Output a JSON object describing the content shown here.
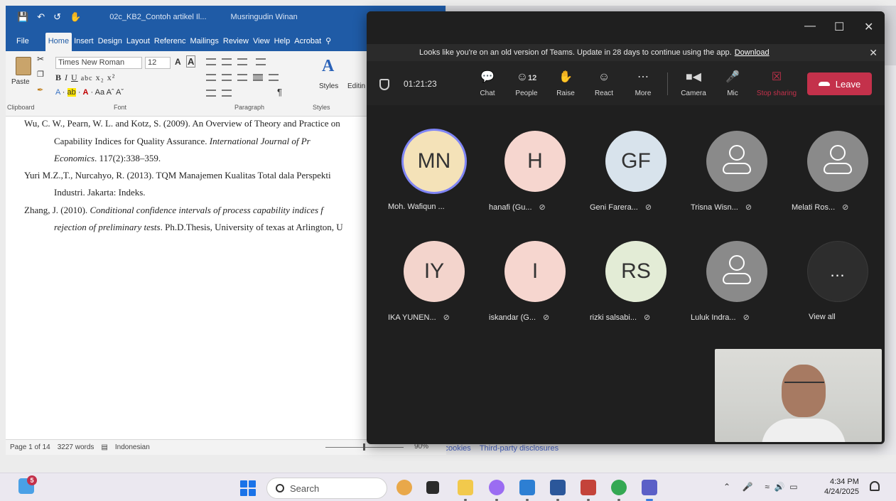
{
  "word": {
    "title": "02c_KB2_Contoh artikel Il...",
    "user": "Musringudin Winan",
    "tabs": [
      "File",
      "Home",
      "Insert",
      "Design",
      "Layout",
      "Referenc",
      "Mailings",
      "Review",
      "View",
      "Help",
      "Acrobat"
    ],
    "font_name": "Times New Roman",
    "font_size": "12",
    "paste_label": "Paste",
    "styles_label": "Styles",
    "editing_label": "Editin",
    "group_labels": [
      "Clipboard",
      "Font",
      "Paragraph",
      "Styles"
    ],
    "references": [
      {
        "text": "Wu, C. W., Pearn, W. L. and Kotz, S. (2009). An Overview of Theory and Practice on",
        "italic": ""
      },
      {
        "text": "Capability Indices for Quality Assurance. ",
        "italic": "International Journal of Pr"
      },
      {
        "text": "",
        "italic": "Economics",
        "tail": ". 117(2):338–359."
      },
      {
        "text": "Yuri M.Z.,T., Nurcahyo, R. (2013). TQM Manajemen Kualitas Total dala Perspekti",
        "italic": ""
      },
      {
        "text": "Industri. Jakarta: Indeks.",
        "italic": ""
      },
      {
        "text": "Zhang, J. (2010). ",
        "italic": "Conditional confidence intervals of process capability indices f"
      },
      {
        "text": "",
        "italic": "rejection of preliminary tests",
        "tail": ". Ph.D.Thesis, University of texas at Arlington, U"
      }
    ],
    "status": {
      "page": "Page 1 of 14",
      "words": "3227 words",
      "language": "Indonesian",
      "zoom": "90%"
    }
  },
  "browser": {
    "links": [
      "l cookies",
      "Third-party disclosures"
    ]
  },
  "teams": {
    "banner": "Looks like you're on an old version of Teams. Update in 28 days to continue using the app.",
    "banner_link": "Download",
    "timer": "01:21:23",
    "people_count": "12",
    "toolbar": [
      {
        "name": "chat",
        "label": "Chat",
        "icon": "chat-icon"
      },
      {
        "name": "people",
        "label": "People",
        "icon": "people-icon"
      },
      {
        "name": "raise",
        "label": "Raise",
        "icon": "hand-icon"
      },
      {
        "name": "react",
        "label": "React",
        "icon": "smile-icon"
      },
      {
        "name": "more",
        "label": "More",
        "icon": "ellipsis-icon"
      },
      {
        "name": "camera",
        "label": "Camera",
        "icon": "camera-icon"
      },
      {
        "name": "mic",
        "label": "Mic",
        "icon": "mic-icon"
      },
      {
        "name": "stop-sharing",
        "label": "Stop sharing",
        "icon": "stop-share-icon"
      }
    ],
    "leave_label": "Leave",
    "participants": [
      {
        "initials": "MN",
        "name": "Moh. Wafiqun ...",
        "color": "#f4e2b8",
        "muted": false,
        "speaking": true
      },
      {
        "initials": "H",
        "name": "hanafi (Gu...",
        "color": "#f6d6cf",
        "muted": true,
        "speaking": false
      },
      {
        "initials": "GF",
        "name": "Geni Farera...",
        "color": "#d8e3ec",
        "muted": true,
        "speaking": false
      },
      {
        "initials": "",
        "name": "Trisna Wisn...",
        "color": "#8a8a8a",
        "muted": true,
        "speaking": false
      },
      {
        "initials": "",
        "name": "Melati Ros...",
        "color": "#8a8a8a",
        "muted": true,
        "speaking": false
      },
      {
        "initials": "IY",
        "name": "IKA YUNEN...",
        "color": "#f3d4cc",
        "muted": true,
        "speaking": false
      },
      {
        "initials": "I",
        "name": "iskandar (G...",
        "color": "#f6d6cf",
        "muted": true,
        "speaking": false
      },
      {
        "initials": "RS",
        "name": "rizki salsabi...",
        "color": "#e3ecd6",
        "muted": true,
        "speaking": false
      },
      {
        "initials": "",
        "name": "Luluk Indra...",
        "color": "#8a8a8a",
        "muted": true,
        "speaking": false
      }
    ],
    "view_all": "View all"
  },
  "taskbar": {
    "widgets_badge": "5",
    "search_label": "Search",
    "clock_time": "4:34 PM",
    "clock_date": "4/24/2025"
  }
}
